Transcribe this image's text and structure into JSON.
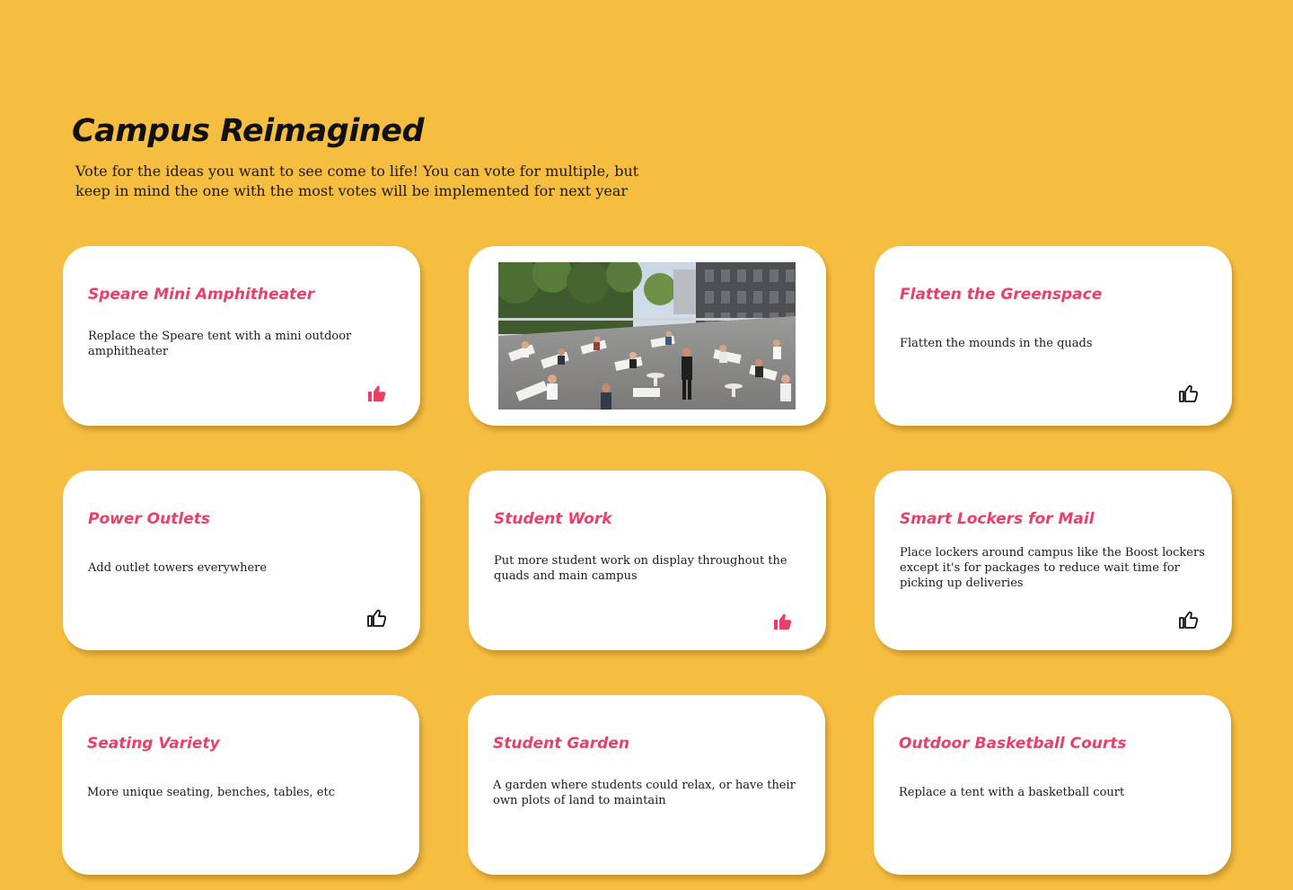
{
  "page": {
    "title": "Campus Reimagined",
    "subtitle": "Vote for the ideas you want to see come to life! You can vote for multiple, but keep in mind the one with the most votes will be implemented for next year"
  },
  "colors": {
    "background": "#f6be41",
    "card": "#ffffff",
    "accent": "#ea3f66",
    "text": "#1a1a1a"
  },
  "photo": {
    "icon": "photo-rooftop-terrace"
  },
  "ideas": [
    {
      "title": "Speare Mini Amphitheater",
      "description": "Replace the Speare tent with a mini outdoor amphitheater",
      "voted": true,
      "icon": "thumbs-up-icon"
    },
    {
      "title": "Flatten the Greenspace",
      "description": "Flatten the mounds in the quads",
      "voted": false,
      "icon": "thumbs-up-icon"
    },
    {
      "title": "Power Outlets",
      "description": "Add outlet towers everywhere",
      "voted": false,
      "icon": "thumbs-up-icon"
    },
    {
      "title": "Student Work",
      "description": "Put more student work on display throughout the quads and main campus",
      "voted": true,
      "icon": "thumbs-up-icon"
    },
    {
      "title": "Smart Lockers for Mail",
      "description": "Place lockers around campus like the Boost lockers except it's for packages to reduce wait time for picking up deliveries",
      "voted": false,
      "icon": "thumbs-up-icon"
    },
    {
      "title": "Seating Variety",
      "description": "More unique seating, benches, tables, etc"
    },
    {
      "title": "Student Garden",
      "description": "A garden where students could relax, or have their own plots of land to maintain"
    },
    {
      "title": "Outdoor Basketball Courts",
      "description": "Replace a tent with a basketball court"
    }
  ]
}
